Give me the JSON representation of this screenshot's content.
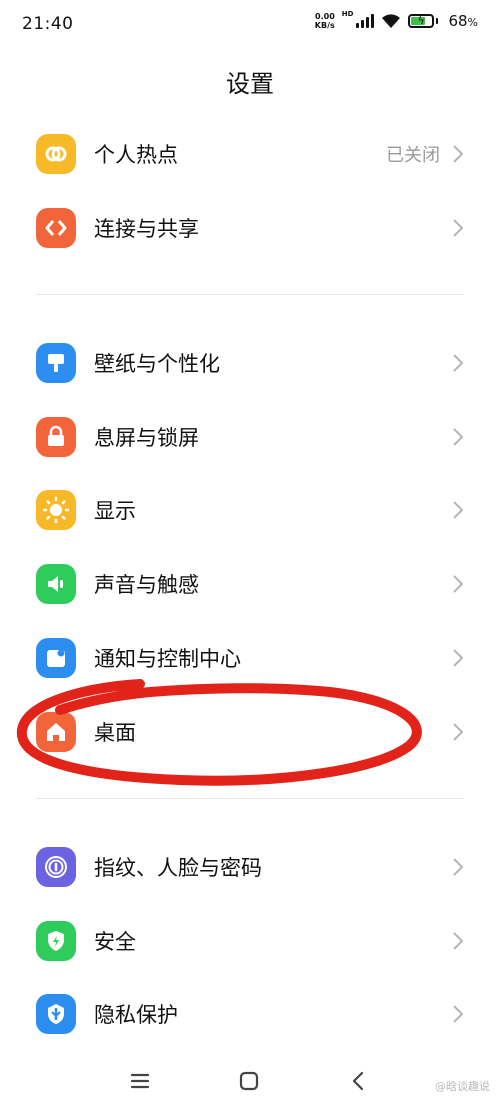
{
  "status_bar": {
    "time": "21:40",
    "speed_value": "0.00",
    "speed_unit": "KB/s",
    "hd_label": "HD",
    "battery_percent": "68",
    "battery_suffix": "%",
    "battery_level": 0.68,
    "battery_color": "#3cc24a"
  },
  "header": {
    "title": "设置"
  },
  "settings": {
    "hotspot": {
      "label": "个人热点",
      "value": "已关闭",
      "icon": "hotspot-icon",
      "color": "#f7b928"
    },
    "connection": {
      "label": "连接与共享",
      "icon": "share-icon",
      "color": "#f2653a"
    },
    "wallpaper": {
      "label": "壁纸与个性化",
      "icon": "wallpaper-icon",
      "color": "#2b8ef0"
    },
    "lockscreen": {
      "label": "息屏与锁屏",
      "icon": "lock-icon",
      "color": "#f2653a"
    },
    "display": {
      "label": "显示",
      "icon": "sun-icon",
      "color": "#f7b928"
    },
    "sound": {
      "label": "声音与触感",
      "icon": "speaker-icon",
      "color": "#2ecc5b"
    },
    "notifications": {
      "label": "通知与控制中心",
      "icon": "notification-icon",
      "color": "#2b8ef0"
    },
    "desktop": {
      "label": "桌面",
      "icon": "home-icon",
      "color": "#f2653a"
    },
    "fingerprint": {
      "label": "指纹、人脸与密码",
      "icon": "fingerprint-icon",
      "color": "#6b63e0"
    },
    "security": {
      "label": "安全",
      "icon": "shield-icon",
      "color": "#2ecc5b"
    },
    "privacy": {
      "label": "隐私保护",
      "icon": "privacy-icon",
      "color": "#2b8ef0"
    }
  },
  "navbar": {
    "menu_icon": "menu-icon",
    "home_icon": "square-icon",
    "back_icon": "back-icon"
  },
  "watermark": "@晗谈趣说",
  "annotation_color": "#e2231a"
}
